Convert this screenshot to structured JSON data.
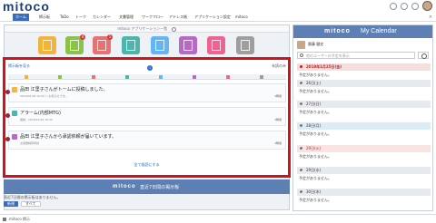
{
  "header": {
    "logo": "mitoco"
  },
  "nav": {
    "items": [
      "ホーム",
      "掲示板",
      "ToDo",
      "トーク",
      "カレンダー",
      "文書管理",
      "ワークフロー",
      "アドレス帳",
      "アプリケーション設定",
      "mitoco"
    ]
  },
  "app_panel": {
    "title": "mitoco アプリケーション一覧",
    "apps": [
      {
        "label": "掲示板",
        "color": "#f2b33a",
        "badge": ""
      },
      {
        "label": "ToDo",
        "color": "#8bc34a",
        "badge": "4"
      },
      {
        "label": "トーク",
        "color": "#e57373",
        "badge": "1"
      },
      {
        "label": "カレンダー",
        "color": "#4db6ac",
        "badge": ""
      },
      {
        "label": "文書管理",
        "color": "#64b5f6",
        "badge": ""
      },
      {
        "label": "ワークフロー",
        "color": "#ba68c8",
        "badge": ""
      },
      {
        "label": "アドレス帳",
        "color": "#f06292",
        "badge": ""
      },
      {
        "label": "アプリケーション設定",
        "color": "#9e9e9e",
        "badge": ""
      }
    ]
  },
  "notices": {
    "top_link": "掲示板を見る",
    "toggle": "未読のみ",
    "items": [
      {
        "title": "品田 江里子さんがトームに投稿しました。",
        "sub": "2019/01/29 10:00 〜 お知らせです。",
        "tag": "1時間"
      },
      {
        "title": "アラーム(内部MTG)",
        "sub": "開始：2019/01/29 10:30",
        "tag": "1時間"
      },
      {
        "title": "品田 江里子さんから承認依頼が届いています。",
        "sub": "交通費精算申請",
        "tag": "1時間"
      }
    ],
    "more": "全て既読にする"
  },
  "footer": {
    "logo": "mitoco",
    "subtitle": "直近7日間の掲示板",
    "note": "直近7日間の掲示板はありません。",
    "btn_primary": "新規",
    "btn_secondary": "すべて"
  },
  "calendar": {
    "logo": "mitoco",
    "title": "My Calendar",
    "user": "齋藤 健史",
    "search_placeholder": "他のユーザーの予定を表示",
    "days": [
      {
        "label": "2019年1月25日(金)",
        "style": "red",
        "note": "予定がありません。"
      },
      {
        "label": "26日(土)",
        "style": "gray",
        "note": "予定がありません。"
      },
      {
        "label": "27日(日)",
        "style": "gray",
        "note": "予定がありません。"
      },
      {
        "label": "28日(月)",
        "style": "blue",
        "note": "予定がありません。"
      },
      {
        "label": "29日(火)",
        "style": "pink",
        "note": "予定がありません。"
      },
      {
        "label": "29日(水)",
        "style": "gray",
        "note": "予定がありません。"
      },
      {
        "label": "30日(木)",
        "style": "gray",
        "note": "予定がありません。"
      }
    ]
  },
  "statusbar": {
    "text": "mitoco 掲示"
  }
}
